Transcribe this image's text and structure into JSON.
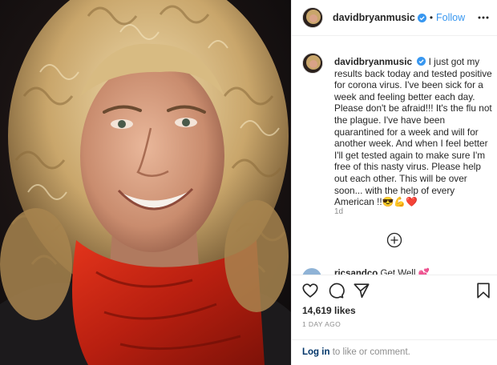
{
  "post": {
    "username": "davidbryanmusic",
    "dot": "•",
    "follow_label": "Follow",
    "caption_username": "davidbryanmusic",
    "caption_text": "I just got my results back today and tested positive for corona virus. I've been sick for a week and feeling better each day. Please don't be afraid!!! It's the flu not the plague. I've have been quarantined for a week and will for another week. And when I feel better I'll get tested again to make sure I'm free of this nasty virus. Please help out each other. This will be over soon... with the help of every American !!😎💪❤️",
    "time_ago": "1d",
    "peek_comment_user": "ricsandco",
    "peek_comment_text": "Get Well 💕",
    "likes": "14,619 likes",
    "date": "1 DAY AGO",
    "login_link": "Log in",
    "login_rest": " to like or comment."
  },
  "icons": {
    "verified": "verified-badge-icon",
    "more": "more-options-icon",
    "load_more": "add-circle-icon",
    "like": "heart-icon",
    "comment": "comment-bubble-icon",
    "share": "send-icon",
    "save": "bookmark-icon"
  },
  "colors": {
    "link_blue": "#3897f0",
    "verified_blue": "#3897f0",
    "secondary_text": "#8e8e8e",
    "login_link": "#003569"
  }
}
